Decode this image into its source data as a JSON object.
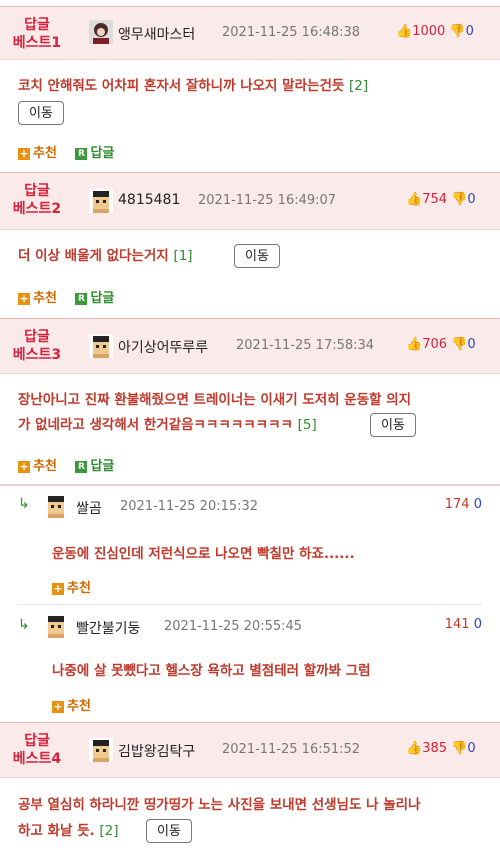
{
  "colors": {
    "best_red": "#d8213a",
    "header_bg": "#fbeaea",
    "vote_blue": "#2c43c8",
    "reply_green": "#2e8b2e"
  },
  "common": {
    "move_label": "이동",
    "recommend_label": "추천",
    "reply_label": "답글",
    "reply_box": "R"
  },
  "bests": [
    {
      "label_line1": "답글",
      "label_line2": "베스트1",
      "user": "앵무새마스터",
      "time": "2021-11-25 16:48:38",
      "up": "1000",
      "down": "0",
      "text_line1": "코치 안해줘도 어차피 혼자서 잘하니까 나오지 말라는건듯",
      "count": "[2]"
    },
    {
      "label_line1": "답글",
      "label_line2": "베스트2",
      "user": "4815481",
      "time": "2021-11-25 16:49:07",
      "up": "754",
      "down": "0",
      "text_line1": "더 이상 배울게 없다는거지",
      "count": "[1]"
    },
    {
      "label_line1": "답글",
      "label_line2": "베스트3",
      "user": "아기상어뚜루루",
      "time": "2021-11-25 17:58:34",
      "up": "706",
      "down": "0",
      "text_line1": "장난아니고 진짜 환불해줬으면 트레이너는 이새기 도저히 운동할 의지",
      "text_line2": "가 없네라고 생각해서 한거같음ㅋㅋㅋㅋㅋㅋㅋㅋ",
      "count": "[5]"
    },
    {
      "label_line1": "답글",
      "label_line2": "베스트4",
      "user": "김밥왕김탁구",
      "time": "2021-11-25 16:51:52",
      "up": "385",
      "down": "0",
      "text_line1": "공부 열심히 하라니깐 띵가띵가 노는 사진을 보내면 선생님도 나 놀리나",
      "text_line2": "하고 화날 듯.",
      "count": "[2]"
    }
  ],
  "replies": [
    {
      "user": "쌀곰",
      "time": "2021-11-25 20:15:32",
      "up": "174",
      "down": "0",
      "text": "운동에 진심인데 저런식으로 나오면 빡칠만 하죠......"
    },
    {
      "user": "빨간불기둥",
      "time": "2021-11-25 20:55:45",
      "up": "141",
      "down": "0",
      "text": "나중에 살 못뺐다고 헬스장 욕하고 별점테러 할까봐 그럼"
    }
  ]
}
